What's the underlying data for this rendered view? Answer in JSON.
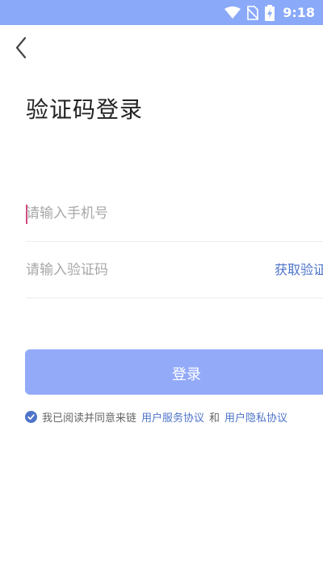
{
  "status_bar": {
    "time": "9:18",
    "icons": [
      "wifi-icon",
      "no-sim-icon",
      "battery-charging-icon"
    ],
    "background": "#8aa9f8"
  },
  "header": {
    "back_icon": "chevron-left-icon",
    "title": "验证码登录"
  },
  "form": {
    "phone": {
      "placeholder": "请输入手机号",
      "value": ""
    },
    "code": {
      "placeholder": "请输入验证码",
      "value": ""
    },
    "get_code_label": "获取验证码"
  },
  "login_button": {
    "label": "登录",
    "color": "#93aaf9"
  },
  "agreement": {
    "checked": true,
    "text": "我已阅读并同意来链",
    "terms_link": "用户服务协议",
    "and": "和",
    "privacy_link": "用户隐私协议",
    "link_color": "#4e74c9"
  }
}
